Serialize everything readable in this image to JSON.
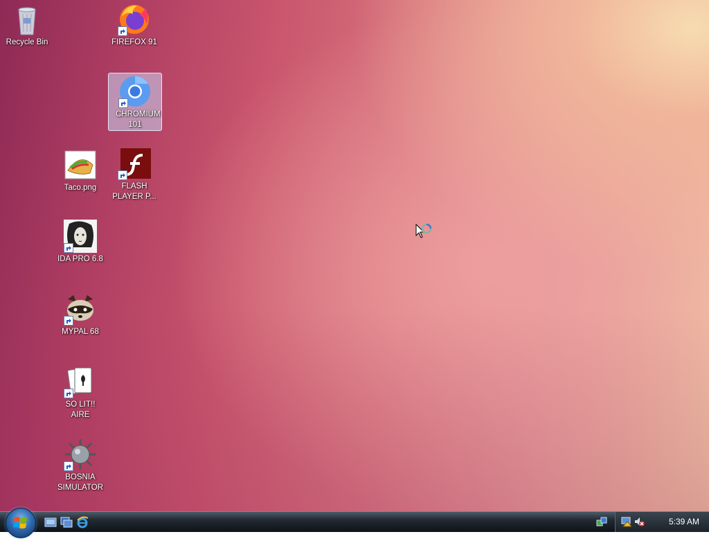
{
  "desktop": {
    "icons": [
      {
        "label": "Recycle Bin",
        "icon": "recycle-bin-icon"
      },
      {
        "label": "FIREFOX 91",
        "icon": "firefox-icon"
      },
      {
        "label": "CHROMIUM 101",
        "icon": "chromium-icon"
      },
      {
        "label": "Taco.png",
        "icon": "taco-image-icon"
      },
      {
        "label": "FLASH PLAYER P...",
        "icon": "flash-player-icon"
      },
      {
        "label": "IDA PRO 6.8",
        "icon": "ida-pro-icon"
      },
      {
        "label": "MYPAL 68",
        "icon": "mypal-raccoon-icon"
      },
      {
        "label": "SO LIT!! AIRE",
        "icon": "solitaire-cards-icon"
      },
      {
        "label": "BOSNIA SIMULATOR",
        "icon": "naval-mine-icon"
      }
    ],
    "selected_icon": "CHROMIUM 101"
  },
  "taskbar": {
    "start_icon": "windows-start-orb",
    "quick_launch": [
      "show-desktop-icon",
      "switch-windows-icon",
      "internet-explorer-icon"
    ],
    "tray_icons": [
      "network-icon",
      "network-alert-icon",
      "volume-muted-icon"
    ],
    "clock": "5:39 AM"
  },
  "colors": {
    "taskbar_dark": "#0e1318",
    "selection": "#c8d7f5",
    "wallpaper_left": "#8e2a55",
    "wallpaper_right": "#f7dcb0"
  }
}
